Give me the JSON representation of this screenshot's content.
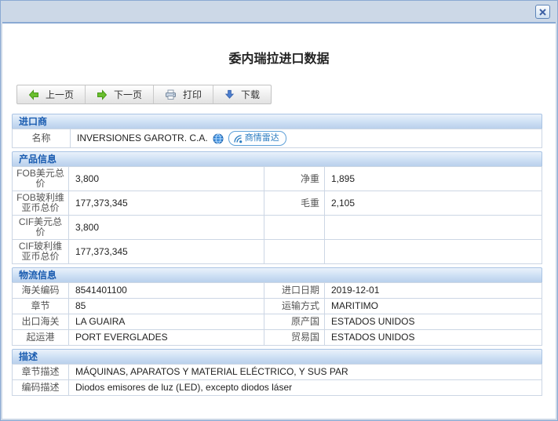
{
  "colors": {
    "titlebar_bg": "#ccd8e7",
    "dialog_border": "#8aa9d3",
    "section_header_text": "#1a5cb0",
    "section_header_bg_top": "#eaf2fb",
    "section_header_bg_bottom": "#b9d0ec",
    "link_blue": "#2c7cc0",
    "prev_next_arrow_green": "#6abf2e",
    "download_arrow_blue": "#4d7fd0",
    "table_border": "#ccd6e4"
  },
  "title": "委内瑞拉进口数据",
  "toolbar": {
    "prev_label": "上一页",
    "next_label": "下一页",
    "print_label": "打印",
    "download_label": "下载"
  },
  "importer": {
    "section_title": "进口商",
    "name_label": "名称",
    "name_value": "INVERSIONES GAROTR. C.A.",
    "radar_link_label": "商情雷达"
  },
  "product": {
    "section_title": "产品信息",
    "rows": [
      {
        "label1": "FOB美元总价",
        "value1": "3,800",
        "label2": "净重",
        "value2": "1,895"
      },
      {
        "label1": "FOB玻利维亚币总价",
        "value1": "177,373,345",
        "label2": "毛重",
        "value2": "2,105"
      },
      {
        "label1": "CIF美元总价",
        "value1": "3,800",
        "label2": "",
        "value2": ""
      },
      {
        "label1": "CIF玻利维亚币总价",
        "value1": "177,373,345",
        "label2": "",
        "value2": ""
      }
    ]
  },
  "logistics": {
    "section_title": "物流信息",
    "rows": [
      {
        "label1": "海关编码",
        "value1": "8541401100",
        "label2": "进口日期",
        "value2": "2019-12-01"
      },
      {
        "label1": "章节",
        "value1": "85",
        "label2": "运输方式",
        "value2": "MARITIMO"
      },
      {
        "label1": "出口海关",
        "value1": "LA GUAIRA",
        "label2": "原产国",
        "value2": "ESTADOS UNIDOS"
      },
      {
        "label1": "起运港",
        "value1": "PORT EVERGLADES",
        "label2": "贸易国",
        "value2": "ESTADOS UNIDOS"
      }
    ]
  },
  "description": {
    "section_title": "描述",
    "rows": [
      {
        "label": "章节描述",
        "value": "MÁQUINAS, APARATOS Y MATERIAL ELÉCTRICO, Y SUS PAR"
      },
      {
        "label": "编码描述",
        "value": "Diodos emisores de luz (LED), excepto diodos láser"
      }
    ]
  }
}
